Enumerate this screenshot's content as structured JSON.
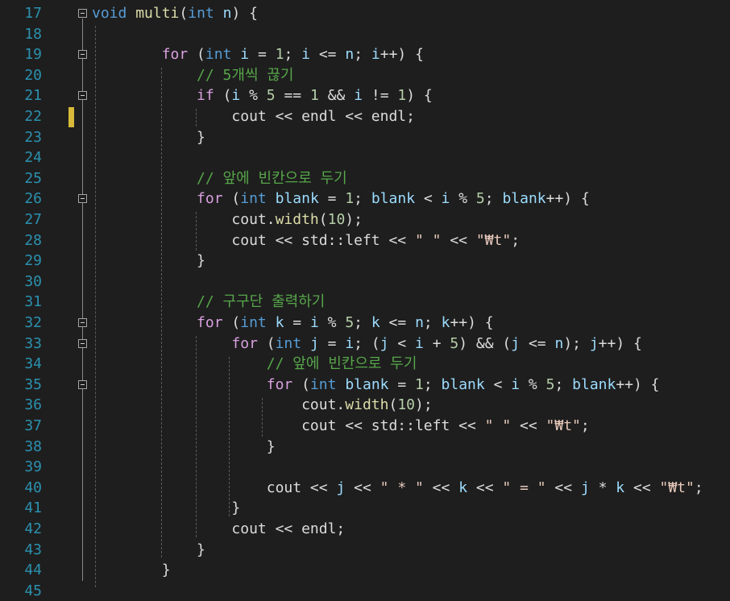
{
  "editor": {
    "colors": {
      "background": "#1e1e1e",
      "line_number": "#2b91af",
      "keyword": "#569cd6",
      "control_keyword": "#d8a0df",
      "function": "#dcdcaa",
      "identifier": "#9cdcfe",
      "number": "#b5cea8",
      "string": "#e8c9bb",
      "comment": "#57a64a",
      "change_marker": "#d7ba3a"
    },
    "lines": [
      {
        "num": "17",
        "fold": true,
        "tokens": [
          [
            "kw",
            "void"
          ],
          [
            "plain",
            " "
          ],
          [
            "fn",
            "multi"
          ],
          [
            "plain",
            "("
          ],
          [
            "kw",
            "int"
          ],
          [
            "plain",
            " "
          ],
          [
            "id",
            "n"
          ],
          [
            "plain",
            ") {"
          ]
        ]
      },
      {
        "num": "18",
        "fold": false,
        "tokens": []
      },
      {
        "num": "19",
        "fold": true,
        "tokens": [
          [
            "plain",
            "        "
          ],
          [
            "kw2",
            "for"
          ],
          [
            "plain",
            " ("
          ],
          [
            "kw",
            "int"
          ],
          [
            "plain",
            " "
          ],
          [
            "id",
            "i"
          ],
          [
            "plain",
            " = "
          ],
          [
            "num",
            "1"
          ],
          [
            "plain",
            "; "
          ],
          [
            "id",
            "i"
          ],
          [
            "plain",
            " <= "
          ],
          [
            "id",
            "n"
          ],
          [
            "plain",
            "; "
          ],
          [
            "id",
            "i"
          ],
          [
            "plain",
            "++) {"
          ]
        ]
      },
      {
        "num": "20",
        "fold": false,
        "tokens": [
          [
            "plain",
            "            "
          ],
          [
            "cm",
            "// 5개씩 끊기"
          ]
        ]
      },
      {
        "num": "21",
        "fold": true,
        "tokens": [
          [
            "plain",
            "            "
          ],
          [
            "kw2",
            "if"
          ],
          [
            "plain",
            " ("
          ],
          [
            "id",
            "i"
          ],
          [
            "plain",
            " % "
          ],
          [
            "num",
            "5"
          ],
          [
            "plain",
            " == "
          ],
          [
            "num",
            "1"
          ],
          [
            "plain",
            " && "
          ],
          [
            "id",
            "i"
          ],
          [
            "plain",
            " != "
          ],
          [
            "num",
            "1"
          ],
          [
            "plain",
            ") {"
          ]
        ]
      },
      {
        "num": "22",
        "fold": false,
        "tokens": [
          [
            "plain",
            "                cout << endl << endl;"
          ]
        ]
      },
      {
        "num": "23",
        "fold": false,
        "tokens": [
          [
            "plain",
            "            }"
          ]
        ]
      },
      {
        "num": "24",
        "fold": false,
        "tokens": []
      },
      {
        "num": "25",
        "fold": false,
        "tokens": [
          [
            "plain",
            "            "
          ],
          [
            "cm",
            "// 앞에 빈칸으로 두기"
          ]
        ]
      },
      {
        "num": "26",
        "fold": true,
        "tokens": [
          [
            "plain",
            "            "
          ],
          [
            "kw2",
            "for"
          ],
          [
            "plain",
            " ("
          ],
          [
            "kw",
            "int"
          ],
          [
            "plain",
            " "
          ],
          [
            "id",
            "blank"
          ],
          [
            "plain",
            " = "
          ],
          [
            "num",
            "1"
          ],
          [
            "plain",
            "; "
          ],
          [
            "id",
            "blank"
          ],
          [
            "plain",
            " < "
          ],
          [
            "id",
            "i"
          ],
          [
            "plain",
            " % "
          ],
          [
            "num",
            "5"
          ],
          [
            "plain",
            "; "
          ],
          [
            "id",
            "blank"
          ],
          [
            "plain",
            "++) {"
          ]
        ]
      },
      {
        "num": "27",
        "fold": false,
        "tokens": [
          [
            "plain",
            "                cout."
          ],
          [
            "fn",
            "width"
          ],
          [
            "plain",
            "("
          ],
          [
            "num",
            "10"
          ],
          [
            "plain",
            ");"
          ]
        ]
      },
      {
        "num": "28",
        "fold": false,
        "tokens": [
          [
            "plain",
            "                cout << std::left << "
          ],
          [
            "str",
            "\" \""
          ],
          [
            "plain",
            " << "
          ],
          [
            "str",
            "\"₩t\""
          ],
          [
            "plain",
            ";"
          ]
        ]
      },
      {
        "num": "29",
        "fold": false,
        "tokens": [
          [
            "plain",
            "            }"
          ]
        ]
      },
      {
        "num": "30",
        "fold": false,
        "tokens": []
      },
      {
        "num": "31",
        "fold": false,
        "tokens": [
          [
            "plain",
            "            "
          ],
          [
            "cm",
            "// 구구단 출력하기"
          ]
        ]
      },
      {
        "num": "32",
        "fold": true,
        "tokens": [
          [
            "plain",
            "            "
          ],
          [
            "kw2",
            "for"
          ],
          [
            "plain",
            " ("
          ],
          [
            "kw",
            "int"
          ],
          [
            "plain",
            " "
          ],
          [
            "id",
            "k"
          ],
          [
            "plain",
            " = "
          ],
          [
            "id",
            "i"
          ],
          [
            "plain",
            " % "
          ],
          [
            "num",
            "5"
          ],
          [
            "plain",
            "; "
          ],
          [
            "id",
            "k"
          ],
          [
            "plain",
            " <= "
          ],
          [
            "id",
            "n"
          ],
          [
            "plain",
            "; "
          ],
          [
            "id",
            "k"
          ],
          [
            "plain",
            "++) {"
          ]
        ]
      },
      {
        "num": "33",
        "fold": true,
        "tokens": [
          [
            "plain",
            "                "
          ],
          [
            "kw2",
            "for"
          ],
          [
            "plain",
            " ("
          ],
          [
            "kw",
            "int"
          ],
          [
            "plain",
            " "
          ],
          [
            "id",
            "j"
          ],
          [
            "plain",
            " = "
          ],
          [
            "id",
            "i"
          ],
          [
            "plain",
            "; ("
          ],
          [
            "id",
            "j"
          ],
          [
            "plain",
            " < "
          ],
          [
            "id",
            "i"
          ],
          [
            "plain",
            " + "
          ],
          [
            "num",
            "5"
          ],
          [
            "plain",
            ") && ("
          ],
          [
            "id",
            "j"
          ],
          [
            "plain",
            " <= "
          ],
          [
            "id",
            "n"
          ],
          [
            "plain",
            "); "
          ],
          [
            "id",
            "j"
          ],
          [
            "plain",
            "++) {"
          ]
        ]
      },
      {
        "num": "34",
        "fold": false,
        "tokens": [
          [
            "plain",
            "                    "
          ],
          [
            "cm",
            "// 앞에 빈칸으로 두기"
          ]
        ]
      },
      {
        "num": "35",
        "fold": true,
        "tokens": [
          [
            "plain",
            "                    "
          ],
          [
            "kw2",
            "for"
          ],
          [
            "plain",
            " ("
          ],
          [
            "kw",
            "int"
          ],
          [
            "plain",
            " "
          ],
          [
            "id",
            "blank"
          ],
          [
            "plain",
            " = "
          ],
          [
            "num",
            "1"
          ],
          [
            "plain",
            "; "
          ],
          [
            "id",
            "blank"
          ],
          [
            "plain",
            " < "
          ],
          [
            "id",
            "i"
          ],
          [
            "plain",
            " % "
          ],
          [
            "num",
            "5"
          ],
          [
            "plain",
            "; "
          ],
          [
            "id",
            "blank"
          ],
          [
            "plain",
            "++) {"
          ]
        ]
      },
      {
        "num": "36",
        "fold": false,
        "tokens": [
          [
            "plain",
            "                        cout."
          ],
          [
            "fn",
            "width"
          ],
          [
            "plain",
            "("
          ],
          [
            "num",
            "10"
          ],
          [
            "plain",
            ");"
          ]
        ]
      },
      {
        "num": "37",
        "fold": false,
        "tokens": [
          [
            "plain",
            "                        cout << std::left << "
          ],
          [
            "str",
            "\" \""
          ],
          [
            "plain",
            " << "
          ],
          [
            "str",
            "\"₩t\""
          ],
          [
            "plain",
            ";"
          ]
        ]
      },
      {
        "num": "38",
        "fold": false,
        "tokens": [
          [
            "plain",
            "                    }"
          ]
        ]
      },
      {
        "num": "39",
        "fold": false,
        "tokens": []
      },
      {
        "num": "40",
        "fold": false,
        "tokens": [
          [
            "plain",
            "                    cout << "
          ],
          [
            "id",
            "j"
          ],
          [
            "plain",
            " << "
          ],
          [
            "str",
            "\" * \""
          ],
          [
            "plain",
            " << "
          ],
          [
            "id",
            "k"
          ],
          [
            "plain",
            " << "
          ],
          [
            "str",
            "\" = \""
          ],
          [
            "plain",
            " << "
          ],
          [
            "id",
            "j"
          ],
          [
            "plain",
            " * "
          ],
          [
            "id",
            "k"
          ],
          [
            "plain",
            " << "
          ],
          [
            "str",
            "\"₩t\""
          ],
          [
            "plain",
            ";"
          ]
        ]
      },
      {
        "num": "41",
        "fold": false,
        "tokens": [
          [
            "plain",
            "                }"
          ]
        ]
      },
      {
        "num": "42",
        "fold": false,
        "tokens": [
          [
            "plain",
            "                cout << endl;"
          ]
        ]
      },
      {
        "num": "43",
        "fold": false,
        "tokens": [
          [
            "plain",
            "            }"
          ]
        ]
      },
      {
        "num": "44",
        "fold": false,
        "tokens": [
          [
            "plain",
            "        }"
          ]
        ]
      },
      {
        "num": "45",
        "fold": false,
        "tokens": []
      }
    ]
  }
}
